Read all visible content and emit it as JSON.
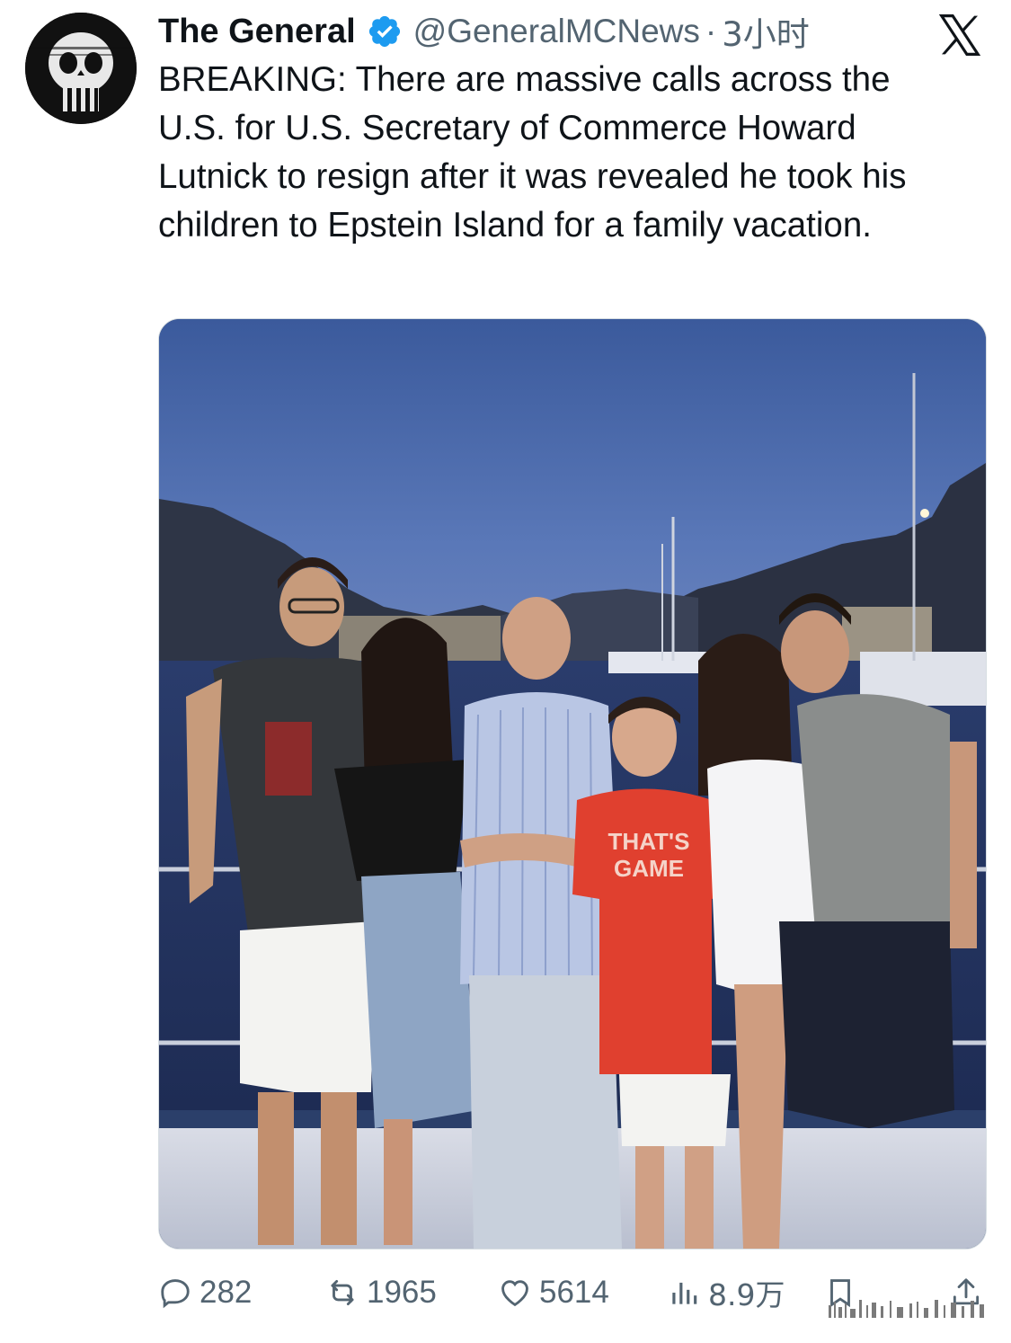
{
  "tweet": {
    "display_name": "The General",
    "handle": "@GeneralMCNews",
    "separator": "·",
    "time": "3小时",
    "text": "BREAKING: There are massive calls across the U.S. for U.S. Secretary of Commerce Howard Lutnick to resign after it was revealed he took his children to Epstein Island for a family vacation."
  },
  "media": {
    "shirt_text_line1": "THAT'S",
    "shirt_text_line2": "GAME"
  },
  "actions": {
    "replies": "282",
    "retweets": "1965",
    "likes": "5614",
    "views": "8.9万"
  },
  "icons": {
    "verified": "verified-badge-icon",
    "platform": "x-logo-icon",
    "reply": "reply-icon",
    "retweet": "retweet-icon",
    "like": "heart-icon",
    "views": "views-icon",
    "bookmark": "bookmark-icon",
    "share": "share-icon"
  },
  "colors": {
    "text": "#0f1419",
    "secondary": "#536471",
    "verified": "#1d9bf0"
  }
}
